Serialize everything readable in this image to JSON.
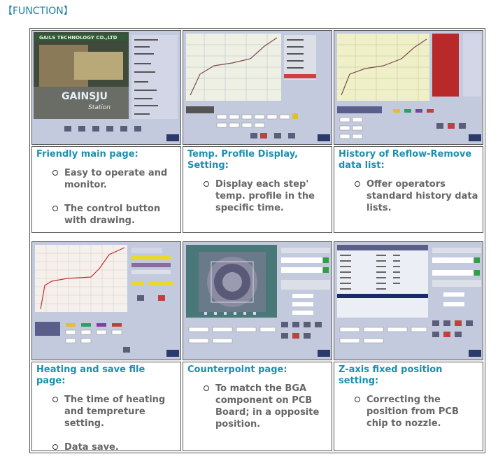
{
  "section_title": "【FUNCTION】",
  "functions": [
    {
      "title": "Friendly main page:",
      "bullets": [
        "Easy to operate and monitor.",
        "The control button with drawing."
      ]
    },
    {
      "title": "Temp. Profile Display, Setting:",
      "bullets": [
        "Display each step' temp. profile in the specific time."
      ]
    },
    {
      "title": "History of Reflow-Remove data list:",
      "bullets": [
        "Offer operators standard history data lists."
      ]
    },
    {
      "title": "Heating and save file page:",
      "bullets": [
        "The time of heating and tempreture setting.",
        "Data save."
      ]
    },
    {
      "title": "Counterpoint page:",
      "bullets": [
        "To match the BGA component on PCB Board; in a opposite position."
      ]
    },
    {
      "title": "Z-axis fixed position setting:",
      "bullets": [
        "Correcting the position from PCB chip to nozzle."
      ]
    }
  ],
  "screenshot_texts": {
    "main_logo": "GAILS TECHNOLOGY CO.,LTD",
    "main_brand": "GAINSJU",
    "main_sub": "Station"
  }
}
